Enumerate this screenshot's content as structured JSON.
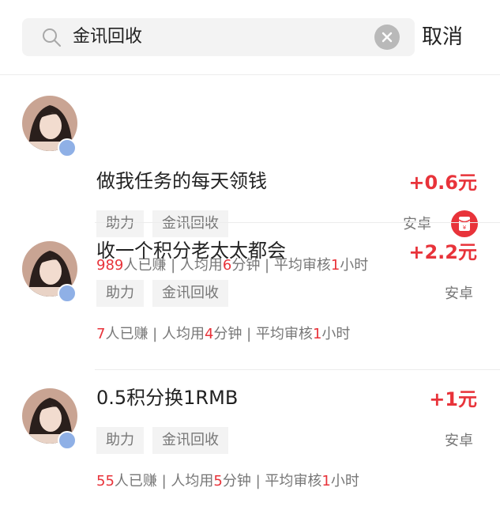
{
  "search": {
    "query": "金讯回收",
    "cancel_label": "取消"
  },
  "icons": {
    "search": "search-icon",
    "clear": "clear-icon",
    "red_packet": "red-packet-icon",
    "verified": "verified-badge-icon"
  },
  "colors": {
    "accent": "#e8333a",
    "tag_bg": "#f3f3f3",
    "muted_text": "#777777"
  },
  "tasks": [
    {
      "title": "做我任务的每天领钱",
      "reward": "+0.6元",
      "tags": [
        "助力",
        "金讯回收"
      ],
      "platform": "安卓",
      "earned_count": "989",
      "earned_label": "人已赚 | 人均用",
      "avg_minutes": "6",
      "avg_label": "分钟 | 平均审核",
      "review_hours": "1",
      "review_label": "小时"
    },
    {
      "title": "收一个积分老太太都会",
      "reward": "+2.2元",
      "tags": [
        "助力",
        "金讯回收"
      ],
      "platform": "安卓",
      "earned_count": "7",
      "earned_label": "人已赚 | 人均用",
      "avg_minutes": "4",
      "avg_label": "分钟 | 平均审核",
      "review_hours": "1",
      "review_label": "小时"
    },
    {
      "title": "0.5积分换1RMB",
      "reward": "+1元",
      "tags": [
        "助力",
        "金讯回收"
      ],
      "platform": "安卓",
      "earned_count": "55",
      "earned_label": "人已赚 | 人均用",
      "avg_minutes": "5",
      "avg_label": "分钟 | 平均审核",
      "review_hours": "1",
      "review_label": "小时"
    }
  ]
}
